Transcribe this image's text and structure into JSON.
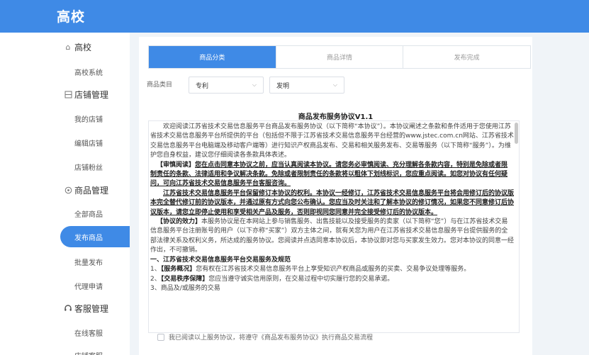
{
  "header": {
    "title": "高校"
  },
  "sidebar": {
    "groups": [
      {
        "label": "高校",
        "icon": "home-icon",
        "items": [
          {
            "label": "高校系统"
          }
        ]
      },
      {
        "label": "店铺管理",
        "icon": "shop-icon",
        "items": [
          {
            "label": "我的店铺"
          },
          {
            "label": "编辑店铺"
          },
          {
            "label": "店铺粉丝"
          }
        ]
      },
      {
        "label": "商品管理",
        "icon": "goods-icon",
        "items": [
          {
            "label": "全部商品"
          },
          {
            "label": "发布商品",
            "active": true
          },
          {
            "label": "批量发布"
          },
          {
            "label": "代理申请"
          }
        ]
      },
      {
        "label": "客服管理",
        "icon": "headset-icon",
        "items": [
          {
            "label": "在线客服"
          },
          {
            "label": "店铺客服"
          }
        ]
      }
    ]
  },
  "steps": [
    {
      "label": "商品分类",
      "active": true
    },
    {
      "label": "商品详情",
      "active": false
    },
    {
      "label": "发布完成",
      "active": false
    }
  ],
  "category": {
    "label": "商品类目",
    "selects": [
      {
        "value": "专利"
      },
      {
        "value": "发明"
      }
    ]
  },
  "agreement": {
    "title": "商品发布服务协议V1.1",
    "p1": "欢迎阅读江苏省技术交易信息服务平台商品发布服务协议（以下简称“本协议”）。本协议阐述之条款和条件适用于您使用江苏省技术交易信息服务平台所提供的平台（包括但不限于江苏省技术交易信息服务平台经营的www.jstec.com.cn网站、江苏省技术交易信息服务平台电脑端及移动客户端等）进行知识产权商品发布、交易和相关服务发布、交易等服务（以下简称“服务”）。为维护您自身权益，建议您仔细阅读各条款具体表述。",
    "p2_head": "【审慎阅读】",
    "p2": "您在点击同意本协议之前，应当认真阅读本协议。请您务必审慎阅读、充分理解各条款内容，特别是免除或者限制责任的条款、法律适用和争议解决条款。免除或者限制责任的条款将以粗体下划线标识，您应重点阅读。如您对协议有任何疑问，可向江苏省技术交易信息服务平台客服咨询。",
    "p3": "江苏省技术交易信息服务平台保留修订本协议的权利。本协议一经修订，江苏省技术交易信息服务平台将会用修订后的协议版本完全替代修订前的协议版本，并通过原有方式向您公布确认。您应当及时关注和了解本协议的修订情况，如果您不同意修订后协议版本，请您立即停止使用和享受相关产品及服务，否则即视同您同意并完全接受修订后的协议版本。",
    "p4_head": "【协议的效力】",
    "p4": "本服务协议是在本网站上参与销售服务、出售技能以及接受服务的卖家（以下简称“您”）与在江苏省技术交易信息服务平台注册账号的用户（以下亦称“买家”）双方主体之间，就有关您为用户在江苏省技术交易信息服务平台提供服务的全部法律关系及权利义务，所达成的服务协议。您阅读并点选同意本协议后，本协议即对您与买家发生效力。您对本协议的同意一经作出，不可撤销。",
    "s1": "一、江苏省技术交易信息服务平台交易服务及规范",
    "i1_num": "1、",
    "i1_head": "【服务概况】",
    "i1": "您有权在江苏省技术交易信息服务平台上享受知识产权商品或服务的买卖、交易争议处理等服务。",
    "i2_num": "2、",
    "i2_head": "【交易秩序保障】",
    "i2": "您应当遵守诚实信用原则，在交易过程中切实履行您的交易承诺。",
    "i3": "3、商品及/或服务的交易"
  },
  "agree": {
    "label": "我已阅读以上服务协议，将遵守《商品发布服务协议》执行商品交易流程"
  }
}
